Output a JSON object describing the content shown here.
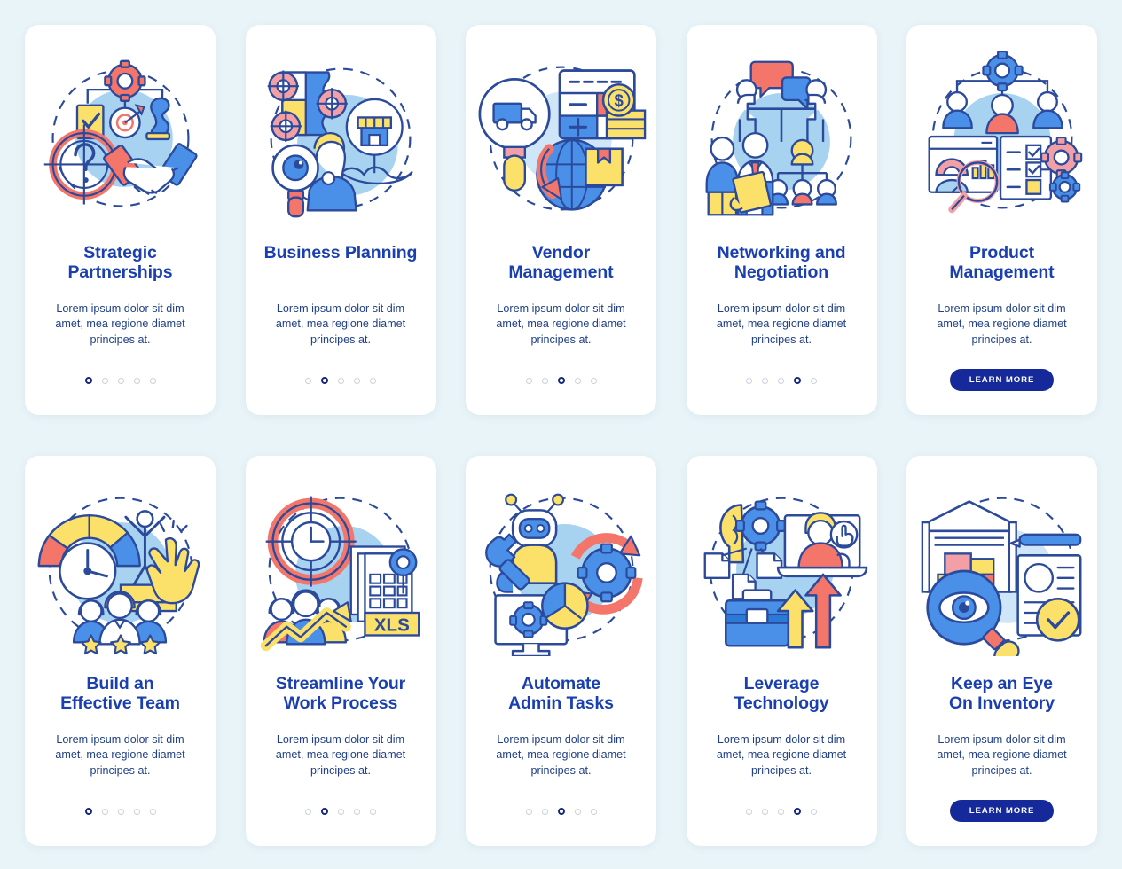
{
  "page": {
    "background_color": "#e8f4f8",
    "card_background": "#ffffff",
    "title_color": "#1a3fb0",
    "body_color": "#1f3f86",
    "accent_blue": "#16299b",
    "dot_inactive_color": "#c9d2dd"
  },
  "palette": {
    "stroke": "#2b4a9b",
    "light_blue_blob": "#a7d2f0",
    "blue": "#4a90e8",
    "blue_dark": "#2f6fd0",
    "coral": "#f4766a",
    "yellow": "#fbe06a",
    "pink": "#f2a0a6",
    "white": "#ffffff"
  },
  "rows": [
    {
      "cards": [
        {
          "id": "strategic-partnerships",
          "illustration": "strategic-partnerships-illustration",
          "title": "Strategic\nPartnerships",
          "description": "Lorem ipsum dolor sit dim amet, mea regione diamet principes at.",
          "dots": {
            "count": 5,
            "active_index": 0
          },
          "cta": null
        },
        {
          "id": "business-planning",
          "illustration": "business-planning-illustration",
          "title": "Business Planning",
          "description": "Lorem ipsum dolor sit dim amet, mea regione diamet principes at.",
          "dots": {
            "count": 5,
            "active_index": 1
          },
          "cta": null
        },
        {
          "id": "vendor-management",
          "illustration": "vendor-management-illustration",
          "title": "Vendor\nManagement",
          "description": "Lorem ipsum dolor sit dim amet, mea regione diamet principes at.",
          "dots": {
            "count": 5,
            "active_index": 2
          },
          "cta": null
        },
        {
          "id": "networking-and-negotiation",
          "illustration": "networking-negotiation-illustration",
          "title": "Networking and\nNegotiation",
          "description": "Lorem ipsum dolor sit dim amet, mea regione diamet principes at.",
          "dots": {
            "count": 5,
            "active_index": 3
          },
          "cta": null
        },
        {
          "id": "product-management",
          "illustration": "product-management-illustration",
          "title": "Product\nManagement",
          "description": "Lorem ipsum dolor sit dim amet, mea regione diamet principes at.",
          "dots": null,
          "cta": "LEARN MORE"
        }
      ]
    },
    {
      "cards": [
        {
          "id": "build-an-effective-team",
          "illustration": "build-effective-team-illustration",
          "title": "Build an\nEffective Team",
          "description": "Lorem ipsum dolor sit dim amet, mea regione diamet principes at.",
          "dots": {
            "count": 5,
            "active_index": 0
          },
          "cta": null
        },
        {
          "id": "streamline-your-work-process",
          "illustration": "streamline-work-process-illustration",
          "title": "Streamline Your\nWork Process",
          "description": "Lorem ipsum dolor sit dim amet, mea regione diamet principes at.",
          "dots": {
            "count": 5,
            "active_index": 1
          },
          "cta": null
        },
        {
          "id": "automate-admin-tasks",
          "illustration": "automate-admin-tasks-illustration",
          "title": "Automate\nAdmin Tasks",
          "description": "Lorem ipsum dolor sit dim amet, mea regione diamet principes at.",
          "dots": {
            "count": 5,
            "active_index": 2
          },
          "cta": null
        },
        {
          "id": "leverage-technology",
          "illustration": "leverage-technology-illustration",
          "title": "Leverage\nTechnology",
          "description": "Lorem ipsum dolor sit dim amet, mea regione diamet principes at.",
          "dots": {
            "count": 5,
            "active_index": 3
          },
          "cta": null
        },
        {
          "id": "keep-an-eye-on-inventory",
          "illustration": "keep-eye-on-inventory-illustration",
          "title": "Keep an Eye\nOn Inventory",
          "description": "Lorem ipsum dolor sit dim amet, mea regione diamet principes at.",
          "dots": null,
          "cta": "LEARN MORE"
        }
      ]
    }
  ]
}
